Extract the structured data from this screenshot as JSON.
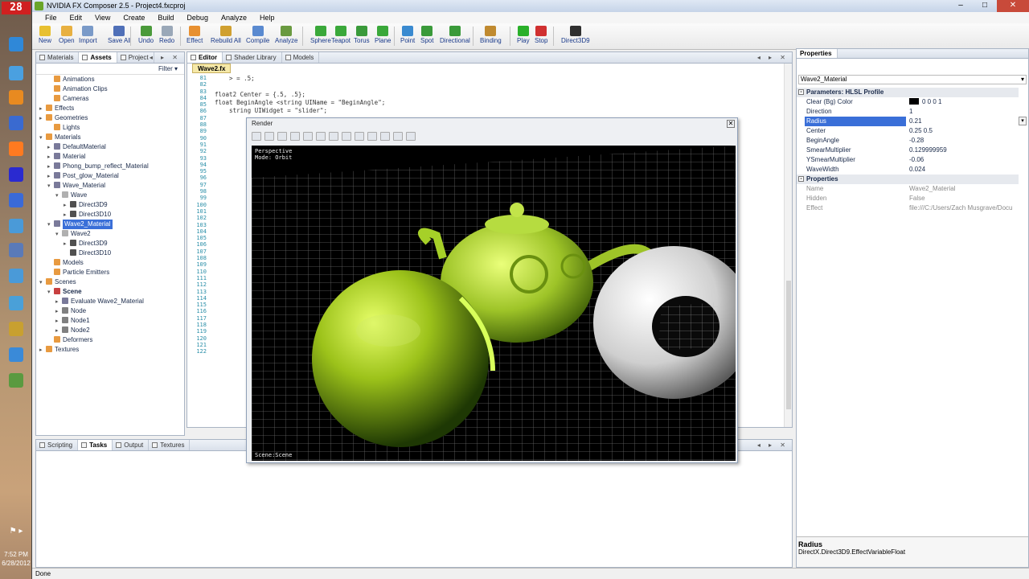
{
  "taskbar": {
    "badge": "28",
    "clock_time": "7:52 PM",
    "clock_date": "6/28/2012",
    "icons": [
      "chrome-icon",
      "explorer-icon",
      "media-player-icon",
      "network-icon",
      "vlc-icon",
      "app-icon",
      "app-icon",
      "app-icon",
      "app-icon",
      "app-icon",
      "app-icon",
      "app-icon",
      "app-icon",
      "app-icon"
    ]
  },
  "window": {
    "title": "NVIDIA FX Composer 2.5 - Project4.fxcproj",
    "minimize": "–",
    "maximize": "□",
    "close": "✕"
  },
  "menu": [
    "File",
    "Edit",
    "View",
    "Create",
    "Build",
    "Debug",
    "Analyze",
    "Help"
  ],
  "toolbar": {
    "buttons": [
      {
        "label": "New",
        "color": "#e8c030"
      },
      {
        "label": "Open",
        "color": "#e8b040"
      },
      {
        "label": "Import",
        "color": "#7a9ac8"
      },
      {
        "label": "Save All",
        "color": "#5070b8"
      },
      {
        "label": "Undo",
        "color": "#4a9a3a"
      },
      {
        "label": "Redo",
        "color": "#9aa8b8"
      },
      {
        "label": "Effect",
        "color": "#e89030"
      },
      {
        "label": "Rebuild All",
        "color": "#d0a030"
      },
      {
        "label": "Compile",
        "color": "#5a8ad0"
      },
      {
        "label": "Analyze",
        "color": "#6a9a40"
      },
      {
        "label": "Sphere",
        "color": "#3aa83a"
      },
      {
        "label": "Teapot",
        "color": "#3aa83a"
      },
      {
        "label": "Torus",
        "color": "#3a9a3a"
      },
      {
        "label": "Plane",
        "color": "#3aa83a"
      },
      {
        "label": "Point",
        "color": "#3a8ad0"
      },
      {
        "label": "Spot",
        "color": "#3a9a3a"
      },
      {
        "label": "Directional",
        "color": "#3a9a3a"
      },
      {
        "label": "Binding",
        "color": "#c08a30"
      },
      {
        "label": "Play",
        "color": "#2ab02a"
      },
      {
        "label": "Stop",
        "color": "#d03030"
      },
      {
        "label": "Direct3D9",
        "color": "#303030"
      }
    ]
  },
  "assets_panel": {
    "tabs": [
      "Materials",
      "Assets",
      "Project"
    ],
    "active_tab": "Assets",
    "filter_label": "Filter ▾",
    "tree": [
      {
        "label": "Animations",
        "depth": 1,
        "exp": "",
        "icon": "#e89a40"
      },
      {
        "label": "Animation Clips",
        "depth": 1,
        "exp": "",
        "icon": "#e89a40"
      },
      {
        "label": "Cameras",
        "depth": 1,
        "exp": "",
        "icon": "#e89a40"
      },
      {
        "label": "Effects",
        "depth": 0,
        "exp": "▸",
        "icon": "#e89a40"
      },
      {
        "label": "Geometries",
        "depth": 0,
        "exp": "▸",
        "icon": "#e89a40"
      },
      {
        "label": "Lights",
        "depth": 1,
        "exp": "",
        "icon": "#e89a40"
      },
      {
        "label": "Materials",
        "depth": 0,
        "exp": "▾",
        "icon": "#e89a40"
      },
      {
        "label": "DefaultMaterial",
        "depth": 1,
        "exp": "▸",
        "icon": "#7a7a9a"
      },
      {
        "label": "Material",
        "depth": 1,
        "exp": "▸",
        "icon": "#7a7a9a"
      },
      {
        "label": "Phong_bump_reflect_Material",
        "depth": 1,
        "exp": "▸",
        "icon": "#7a7a9a"
      },
      {
        "label": "Post_glow_Material",
        "depth": 1,
        "exp": "▸",
        "icon": "#7a7a9a"
      },
      {
        "label": "Wave_Material",
        "depth": 1,
        "exp": "▾",
        "icon": "#7a7a9a"
      },
      {
        "label": "Wave",
        "depth": 2,
        "exp": "▾",
        "icon": "#b0b0b0"
      },
      {
        "label": "Direct3D9",
        "depth": 3,
        "exp": "▸",
        "icon": "#505050"
      },
      {
        "label": "Direct3D10",
        "depth": 3,
        "exp": "▸",
        "icon": "#505050"
      },
      {
        "label": "Wave2_Material",
        "depth": 1,
        "exp": "▾",
        "icon": "#7a7a9a",
        "selected": true
      },
      {
        "label": "Wave2",
        "depth": 2,
        "exp": "▾",
        "icon": "#b0b0b0"
      },
      {
        "label": "Direct3D9",
        "depth": 3,
        "exp": "▸",
        "icon": "#505050"
      },
      {
        "label": "Direct3D10",
        "depth": 3,
        "exp": "",
        "icon": "#505050"
      },
      {
        "label": "Models",
        "depth": 1,
        "exp": "",
        "icon": "#e89a40"
      },
      {
        "label": "Particle Emitters",
        "depth": 1,
        "exp": "",
        "icon": "#e89a40"
      },
      {
        "label": "Scenes",
        "depth": 0,
        "exp": "▾",
        "icon": "#e89a40"
      },
      {
        "label": "Scene",
        "depth": 1,
        "exp": "▾",
        "icon": "#c84040",
        "bold": true
      },
      {
        "label": "Evaluate Wave2_Material",
        "depth": 2,
        "exp": "▸",
        "icon": "#7a7a9a"
      },
      {
        "label": "Node",
        "depth": 2,
        "exp": "▸",
        "icon": "#808080"
      },
      {
        "label": "Node1",
        "depth": 2,
        "exp": "▸",
        "icon": "#808080"
      },
      {
        "label": "Node2",
        "depth": 2,
        "exp": "▸",
        "icon": "#808080"
      },
      {
        "label": "Deformers",
        "depth": 1,
        "exp": "",
        "icon": "#e89a40"
      },
      {
        "label": "Textures",
        "depth": 0,
        "exp": "▸",
        "icon": "#e89a40"
      }
    ]
  },
  "editor": {
    "tabs": [
      "Editor",
      "Shader Library",
      "Models"
    ],
    "active_tab": "Editor",
    "doc_tab": "Wave2.fx",
    "line_numbers": [
      "81",
      "82",
      "83",
      "84",
      "85",
      "86",
      "87",
      "88",
      "89",
      "90",
      "91",
      "92",
      "93",
      "94",
      "95",
      "96",
      "97",
      "98",
      "99",
      "100",
      "101",
      "102",
      "103",
      "104",
      "105",
      "106",
      "107",
      "108",
      "109",
      "110",
      "111",
      "112",
      "113",
      "114",
      "115",
      "116",
      "117",
      "118",
      "119",
      "120",
      "121",
      "122"
    ],
    "code_lines": [
      "    > = .5;",
      "",
      "float2 Center = {.5, .5};",
      "float BeginAngle <string UIName = \"BeginAngle\";",
      "    string UIWidget = \"slider\";"
    ]
  },
  "render": {
    "title": "Render",
    "close": "✕",
    "viewport_line1": "Perspective",
    "viewport_line2": "Mode: Orbit",
    "scene_label": "Scene:Scene"
  },
  "properties": {
    "title": "Properties",
    "selector": "Wave2_Material",
    "rows": [
      {
        "type": "cat",
        "key": "Parameters: HLSL Profile",
        "value": ""
      },
      {
        "type": "row",
        "key": "Clear (Bg) Color",
        "value": "0 0 0 1",
        "swatch": "#000000"
      },
      {
        "type": "row",
        "key": "Direction",
        "value": "1"
      },
      {
        "type": "sel",
        "key": "Radius",
        "value": "0.21"
      },
      {
        "type": "row",
        "key": "Center",
        "value": "0.25 0.5"
      },
      {
        "type": "row",
        "key": "BeginAngle",
        "value": "-0.28"
      },
      {
        "type": "row",
        "key": "SmearMultiplier",
        "value": "0.129999959"
      },
      {
        "type": "row",
        "key": "YSmearMultiplier",
        "value": "-0.06"
      },
      {
        "type": "row",
        "key": "WaveWidth",
        "value": "0.024"
      },
      {
        "type": "cat",
        "key": "Properties",
        "value": ""
      },
      {
        "type": "dim",
        "key": "Name",
        "value": "Wave2_Material"
      },
      {
        "type": "dim",
        "key": "Hidden",
        "value": "False"
      },
      {
        "type": "dim",
        "key": "Effect",
        "value": "file:///C:/Users/Zach Musgrave/Docu"
      }
    ],
    "desc_title": "Radius",
    "desc_text": "DirectX.Direct3D9.EffectVariableFloat"
  },
  "bottom": {
    "tabs": [
      "Scripting",
      "Tasks",
      "Output",
      "Textures"
    ],
    "active_tab": "Tasks"
  },
  "status": "Done"
}
